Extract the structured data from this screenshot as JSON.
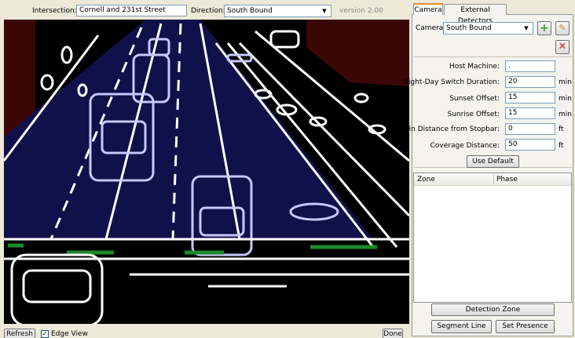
{
  "header": {
    "intersection_label": "Intersection:",
    "intersection_value": "Cornell and 231st Street",
    "direction_label": "Direction:",
    "direction_value": "South Bound",
    "version": "version 2.00"
  },
  "bottom": {
    "refresh_label": "Refresh",
    "edge_view_label": "Edge View",
    "edge_view_checked": true,
    "done_label": "Done"
  },
  "tabs": [
    {
      "label": "Camera",
      "active": true
    },
    {
      "label": "External Detectors",
      "active": false
    }
  ],
  "camera": {
    "camera_label": "Camera:",
    "camera_value": "South Bound",
    "fields": [
      {
        "label": "Host Machine:",
        "value": ".",
        "unit": ""
      },
      {
        "label": "Night-Day Switch Duration:",
        "value": "20",
        "unit": "min"
      },
      {
        "label": "Sunset Offset:",
        "value": "15",
        "unit": "min"
      },
      {
        "label": "Sunrise Offset:",
        "value": "15",
        "unit": "min"
      },
      {
        "label": "Min Distance from Stopbar:",
        "value": "0",
        "unit": "ft"
      },
      {
        "label": "Coverage Distance:",
        "value": "50",
        "unit": "ft"
      }
    ],
    "use_default_label": "Use Default",
    "table_headers": [
      "Zone",
      "Phase"
    ],
    "detection_zone_label": "Detection Zone",
    "segment_line_label": "Segment Line",
    "set_presence_label": "Set Presence"
  },
  "colors": {
    "window_bg": "#ece9d8",
    "lane_overlay": "#10104a",
    "stopbar_green": "#1e8a2a",
    "vehicle_edges": "#c8c8ff",
    "add_icon": "#2ea82e",
    "delete_icon": "#d42222"
  },
  "icons": [
    "add-camera-icon",
    "edit-camera-icon",
    "delete-camera-icon",
    "combo-arrow-icon",
    "checkbox-check-icon"
  ]
}
